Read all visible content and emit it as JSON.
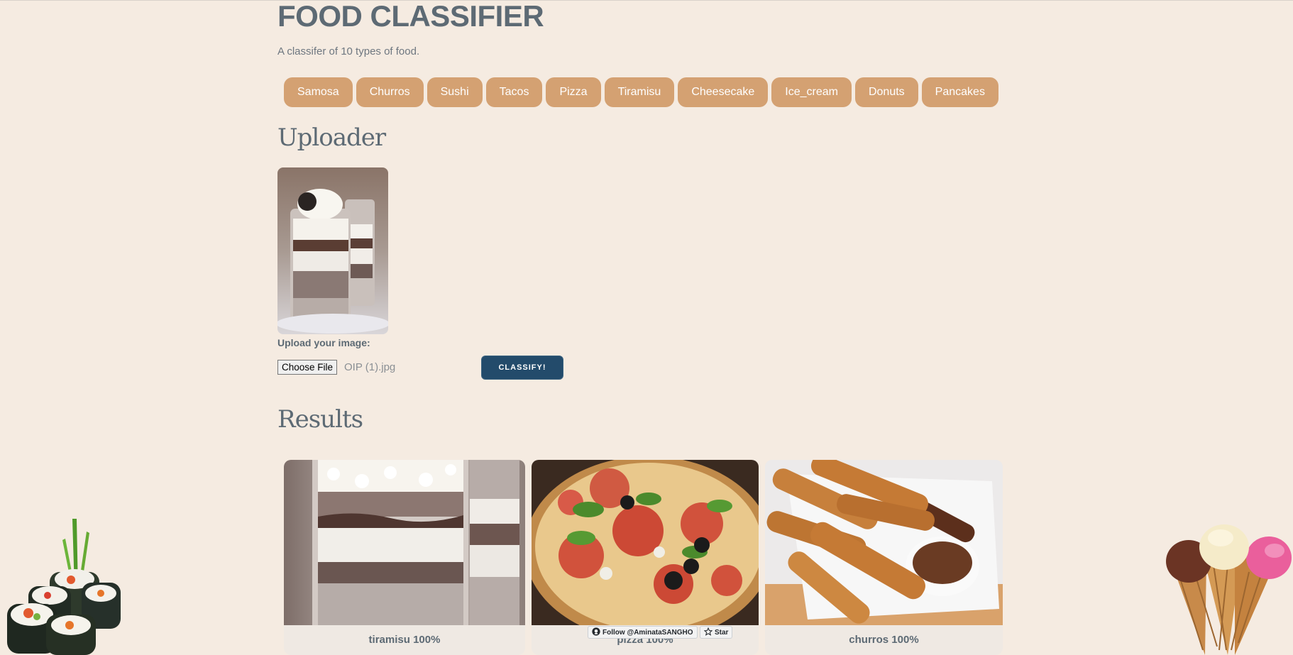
{
  "header": {
    "title": "FOOD CLASSIFIER",
    "subtitle": "A classifer of 10 types of food."
  },
  "categories": [
    "Samosa",
    "Churros",
    "Sushi",
    "Tacos",
    "Pizza",
    "Tiramisu",
    "Cheesecake",
    "Ice_cream",
    "Donuts",
    "Pancakes"
  ],
  "uploader": {
    "heading": "Uploader",
    "label": "Upload your image:",
    "choose_button": "Choose File",
    "file_name": "OIP (1).jpg",
    "classify_button": "CLASSIFY!"
  },
  "results": {
    "heading": "Results",
    "items": [
      {
        "label": "tiramisu 100%",
        "image": "tiramisu-photo"
      },
      {
        "label": "pizza 100%",
        "image": "pizza-photo"
      },
      {
        "label": "churros 100%",
        "image": "churros-photo"
      }
    ]
  },
  "github": {
    "follow": "Follow @AminataSANGHO",
    "star": "Star"
  },
  "colors": {
    "background": "#f5ebe1",
    "category_button": "#d4a172",
    "classify_button": "#234b6b",
    "text": "#5d6a74"
  },
  "decorations": [
    "sushi-roll-image",
    "ice-cream-cones-image"
  ]
}
